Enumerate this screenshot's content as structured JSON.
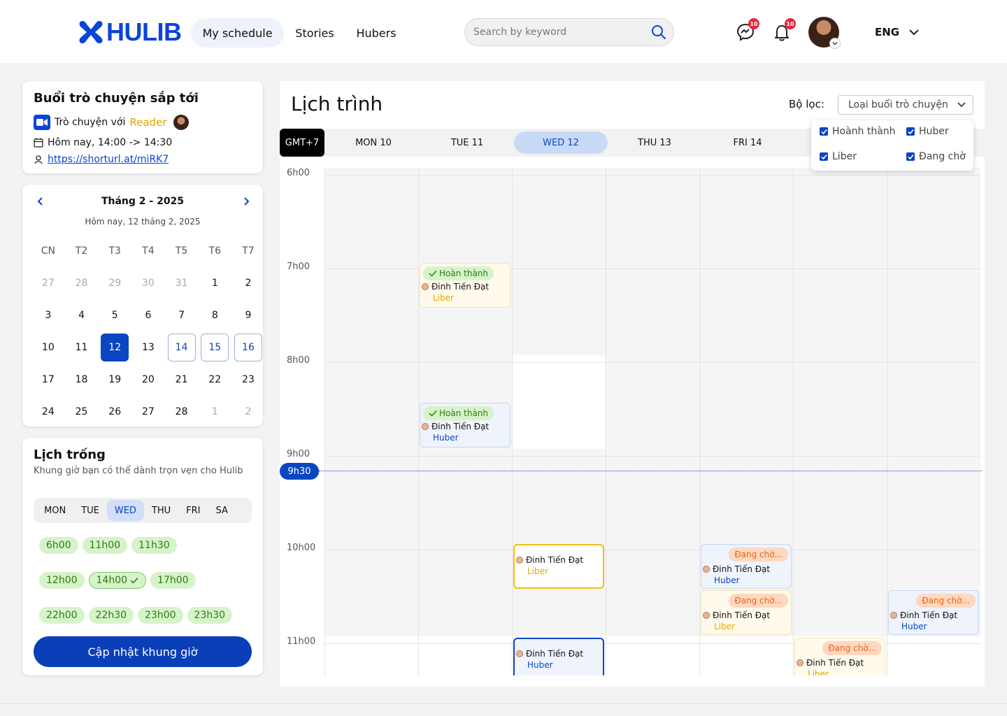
{
  "header": {
    "logo_text": "HULIB",
    "nav": [
      "My schedule",
      "Stories",
      "Hubers"
    ],
    "search_placeholder": "Search by keyword",
    "messenger_badge": "10",
    "notification_badge": "10",
    "language": "ENG",
    "brand_color": "#0a45d9"
  },
  "upcoming": {
    "title": "Buổi trò chuyện sắp tới",
    "chat_prefix": "Trò chuyện với",
    "chat_role": "Reader",
    "time": "Hôm nay, 14:00 -> 14:30",
    "link": "https://shorturl.at/miRK7"
  },
  "minical": {
    "month": "Tháng 2 - 2025",
    "today": "Hôm nay, 12 tháng 2, 2025",
    "weekdays": [
      "CN",
      "T2",
      "T3",
      "T4",
      "T5",
      "T6",
      "T7"
    ],
    "days": [
      {
        "d": "27",
        "s": "muted"
      },
      {
        "d": "28",
        "s": "muted"
      },
      {
        "d": "29",
        "s": "muted"
      },
      {
        "d": "30",
        "s": "muted"
      },
      {
        "d": "31",
        "s": "muted"
      },
      {
        "d": "1",
        "s": ""
      },
      {
        "d": "2",
        "s": ""
      },
      {
        "d": "3",
        "s": ""
      },
      {
        "d": "4",
        "s": ""
      },
      {
        "d": "5",
        "s": ""
      },
      {
        "d": "6",
        "s": ""
      },
      {
        "d": "7",
        "s": ""
      },
      {
        "d": "8",
        "s": ""
      },
      {
        "d": "9",
        "s": ""
      },
      {
        "d": "10",
        "s": ""
      },
      {
        "d": "11",
        "s": ""
      },
      {
        "d": "12",
        "s": "sel"
      },
      {
        "d": "13",
        "s": ""
      },
      {
        "d": "14",
        "s": "out"
      },
      {
        "d": "15",
        "s": "out"
      },
      {
        "d": "16",
        "s": "out"
      },
      {
        "d": "17",
        "s": ""
      },
      {
        "d": "18",
        "s": ""
      },
      {
        "d": "19",
        "s": ""
      },
      {
        "d": "20",
        "s": ""
      },
      {
        "d": "21",
        "s": ""
      },
      {
        "d": "22",
        "s": ""
      },
      {
        "d": "23",
        "s": ""
      },
      {
        "d": "24",
        "s": ""
      },
      {
        "d": "25",
        "s": ""
      },
      {
        "d": "26",
        "s": ""
      },
      {
        "d": "27",
        "s": ""
      },
      {
        "d": "28",
        "s": ""
      },
      {
        "d": "1",
        "s": "muted"
      },
      {
        "d": "2",
        "s": "muted"
      }
    ]
  },
  "free": {
    "title": "Lịch trống",
    "subtitle": "Khung giờ bạn có thể dành trọn vẹn cho Hulib",
    "tabs": [
      "MON",
      "TUE",
      "WED",
      "THU",
      "FRI",
      "SA"
    ],
    "active_tab": "WED",
    "slots_row1": [
      "6h00",
      "11h00",
      "11h30"
    ],
    "slots_row2": [
      "12h00",
      "14h00",
      "17h00"
    ],
    "slots_row3": [
      "22h00",
      "22h30",
      "23h00",
      "23h30"
    ],
    "picked_slot": "14h00",
    "update_button": "Cập nhật khung giờ"
  },
  "schedule": {
    "title": "Lịch trình",
    "filter_label": "Bộ lọc:",
    "filter_value": "Loại buổi trò chuyện",
    "filter_options": [
      "Hoành thành",
      "Huber",
      "Liber",
      "Đang chờ"
    ],
    "timezone": "GMT+7",
    "days": [
      "MON 10",
      "TUE 11",
      "WED 12",
      "THU 13",
      "FRI 14"
    ],
    "today_day": "WED 12",
    "hours": [
      "6h00",
      "7h00",
      "8h00",
      "9h00",
      "10h00",
      "11h00"
    ],
    "now_label": "9h30",
    "person": "Đinh Tiến Đạt",
    "done_label": "Hoàn thành",
    "wait_label": "Đang chờ...",
    "role_liber": "Liber",
    "role_huber": "Huber"
  }
}
